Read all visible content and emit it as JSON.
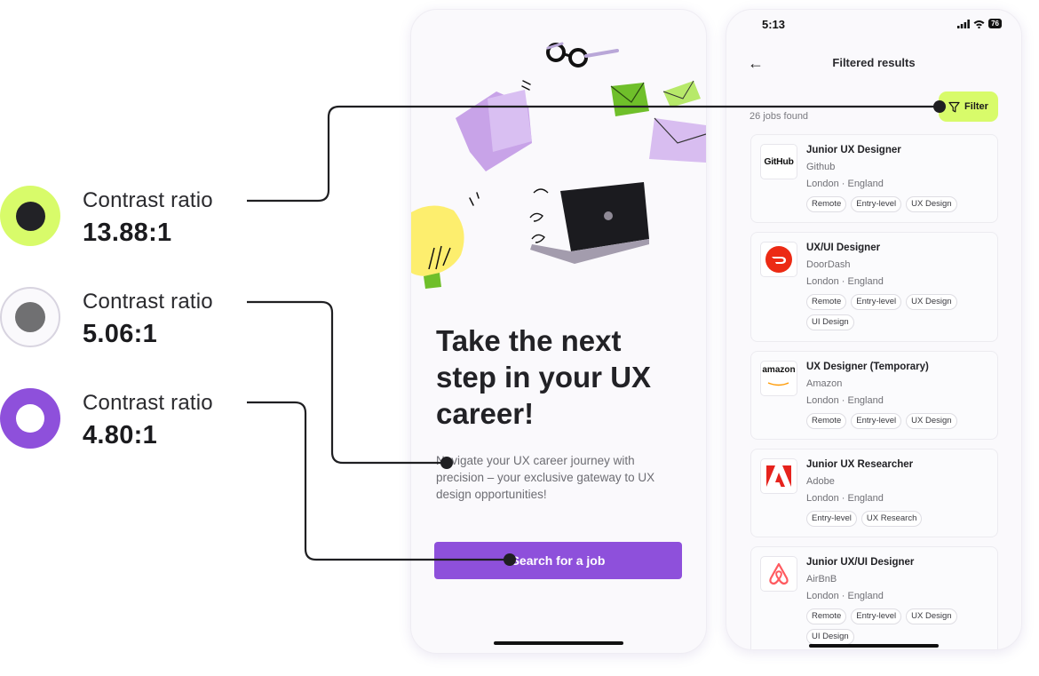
{
  "legend": [
    {
      "label": "Contrast ratio",
      "value": "13.88:1"
    },
    {
      "label": "Contrast ratio",
      "value": "5.06:1"
    },
    {
      "label": "Contrast ratio",
      "value": "4.80:1"
    }
  ],
  "colors": {
    "lime": "#d8fb6a",
    "purple": "#8e50db",
    "dark_text": "#222226",
    "grey_text": "#6d6d73",
    "connector": "#1f1f22"
  },
  "landing": {
    "headline": "Take the next step in your UX career!",
    "subtext": "Navigate your UX career journey with precision – your exclusive gateway to UX design opportunities!",
    "cta_label": "Search for a job"
  },
  "results": {
    "status_time": "5:13",
    "battery": "76",
    "title": "Filtered results",
    "filter_label": "Filter",
    "jobs_found": "26 jobs found",
    "jobs": [
      {
        "title": "Junior UX Designer",
        "company": "Github",
        "location": "London · England",
        "tags": [
          "Remote",
          "Entry-level",
          "UX Design"
        ],
        "logo": "github-logo"
      },
      {
        "title": "UX/UI Designer",
        "company": "DoorDash",
        "location": "London · England",
        "tags": [
          "Remote",
          "Entry-level",
          "UX Design",
          "UI Design"
        ],
        "logo": "doordash-logo"
      },
      {
        "title": "UX Designer (Temporary)",
        "company": "Amazon",
        "location": "London · England",
        "tags": [
          "Remote",
          "Entry-level",
          "UX Design"
        ],
        "logo": "amazon-logo"
      },
      {
        "title": "Junior UX Researcher",
        "company": "Adobe",
        "location": "London · England",
        "tags": [
          "Entry-level",
          "UX Research"
        ],
        "logo": "adobe-logo"
      },
      {
        "title": "Junior UX/UI Designer",
        "company": "AirBnB",
        "location": "London · England",
        "tags": [
          "Remote",
          "Entry-level",
          "UX Design",
          "UI Design"
        ],
        "logo": "airbnb-logo"
      }
    ]
  },
  "logos": {
    "github": "GitHub",
    "amazon": "amazon"
  }
}
